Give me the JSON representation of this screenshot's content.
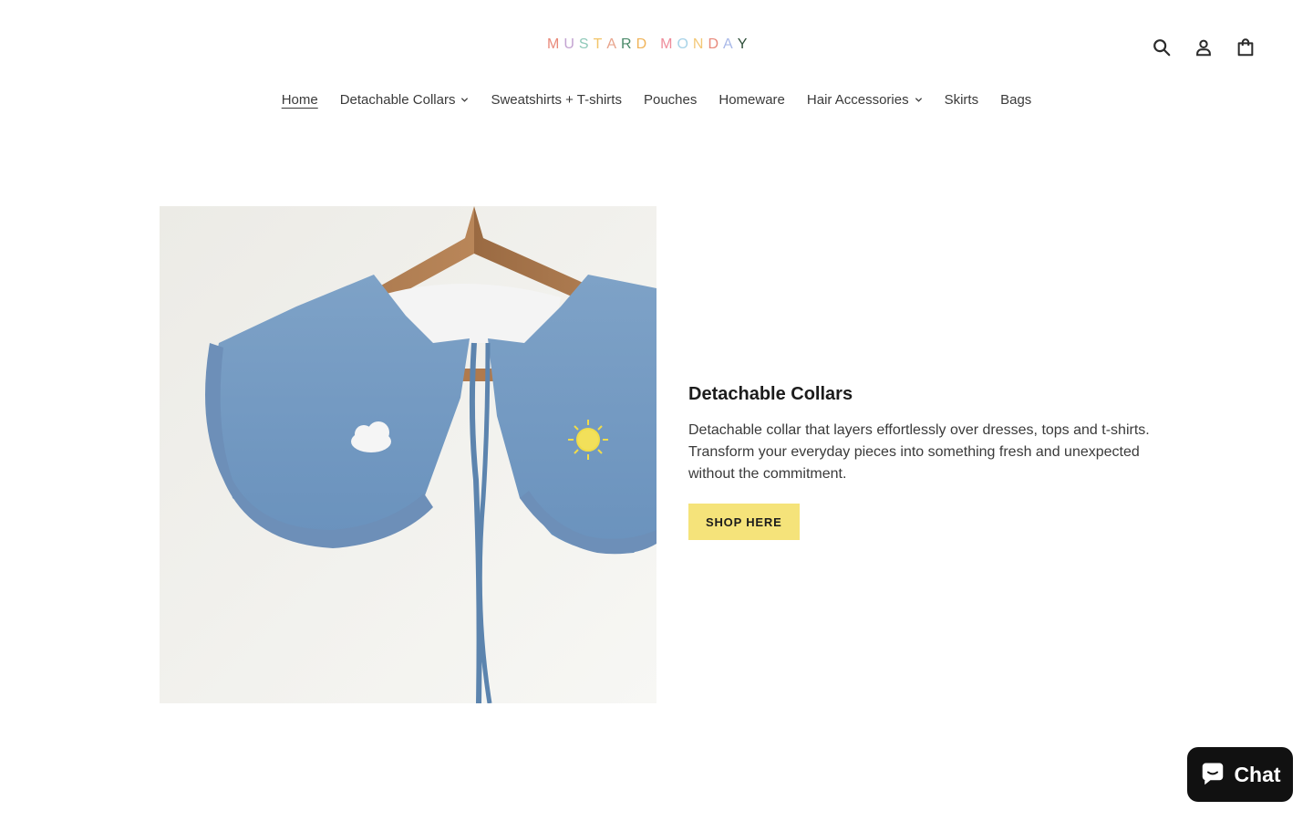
{
  "brand": {
    "logo_letters": [
      {
        "char": "M",
        "color": "#e98a7a"
      },
      {
        "char": "U",
        "color": "#c3a3d1"
      },
      {
        "char": "S",
        "color": "#8fc9b9"
      },
      {
        "char": "T",
        "color": "#f2c56a"
      },
      {
        "char": "A",
        "color": "#e8a48c"
      },
      {
        "char": "R",
        "color": "#4b8a6a"
      },
      {
        "char": "D",
        "color": "#f0b45a"
      },
      {
        "char": "M",
        "color": "#ee8c9a"
      },
      {
        "char": "O",
        "color": "#a7d3e8"
      },
      {
        "char": "N",
        "color": "#f3c877"
      },
      {
        "char": "D",
        "color": "#e88a7c"
      },
      {
        "char": "A",
        "color": "#a8b8e8"
      },
      {
        "char": "Y",
        "color": "#2f4f3a"
      }
    ]
  },
  "header": {
    "icons": [
      "search-icon",
      "account-icon",
      "cart-icon"
    ]
  },
  "nav": {
    "items": [
      {
        "label": "Home",
        "active": true,
        "dropdown": false
      },
      {
        "label": "Detachable Collars",
        "active": false,
        "dropdown": true
      },
      {
        "label": "Sweatshirts + T-shirts",
        "active": false,
        "dropdown": false
      },
      {
        "label": "Pouches",
        "active": false,
        "dropdown": false
      },
      {
        "label": "Homeware",
        "active": false,
        "dropdown": false
      },
      {
        "label": "Hair Accessories",
        "active": false,
        "dropdown": true
      },
      {
        "label": "Skirts",
        "active": false,
        "dropdown": false
      },
      {
        "label": "Bags",
        "active": false,
        "dropdown": false
      }
    ]
  },
  "feature": {
    "title": "Detachable Collars",
    "description": "Detachable collar that layers effortlessly over dresses, tops and t-shirts. Transform your everyday pieces into something fresh and unexpected without the commitment.",
    "button_label": "SHOP HERE",
    "button_color": "#f5e37a"
  },
  "chat": {
    "label": "Chat"
  }
}
